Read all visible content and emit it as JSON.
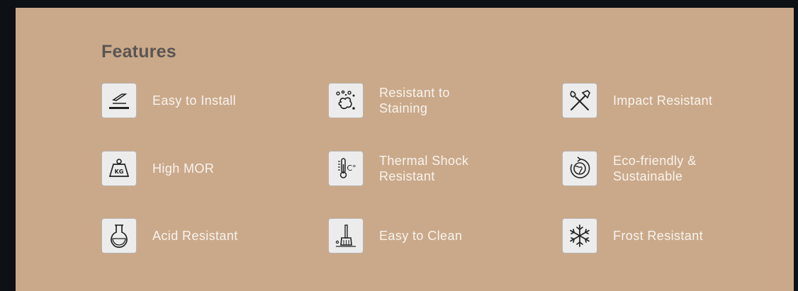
{
  "section": {
    "title": "Features"
  },
  "features": [
    {
      "label": "Easy to Install",
      "icon": "install-icon"
    },
    {
      "label": "Resistant to Staining",
      "icon": "stain-icon"
    },
    {
      "label": "Impact Resistant",
      "icon": "hammer-wrench-icon"
    },
    {
      "label": "High MOR",
      "icon": "weight-kg-icon"
    },
    {
      "label": "Thermal Shock Resistant",
      "icon": "thermometer-icon"
    },
    {
      "label": "Eco-friendly & Sustainable",
      "icon": "globe-recycle-icon"
    },
    {
      "label": "Acid Resistant",
      "icon": "flask-icon"
    },
    {
      "label": "Easy to Clean",
      "icon": "broom-icon"
    },
    {
      "label": "Frost Resistant",
      "icon": "snowflake-icon"
    }
  ],
  "colors": {
    "page_background": "#0d1116",
    "panel_background": "#caa98a",
    "title_text": "#5a5552",
    "label_text": "#f8f3ee",
    "icon_background": "#ececec"
  }
}
